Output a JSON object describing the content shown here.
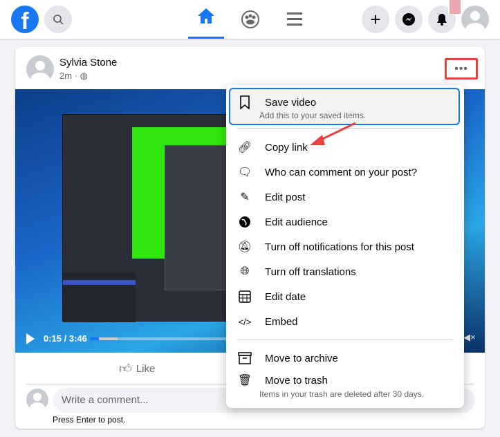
{
  "header": {
    "icons": [
      "facebook-logo",
      "search-icon",
      "home-icon",
      "groups-icon",
      "menu-icon",
      "plus-icon",
      "messenger-icon",
      "bell-icon",
      "avatar"
    ],
    "accent": "#1877f2"
  },
  "post": {
    "author": "Sylvia Stone",
    "time": "2m",
    "separator": "·",
    "video": {
      "time": "0:15 / 3:46",
      "progress": 0.066,
      "buffered": 0.2
    },
    "like_label": "Like",
    "comment_placeholder": "Write a comment...",
    "press_enter": "Press Enter to post."
  },
  "menu": {
    "items": [
      {
        "label": "Save video",
        "sub": "Add this to your saved items.",
        "icon": "bookmark-icon"
      },
      {
        "label": "Copy link",
        "icon": "link-icon"
      },
      {
        "label": "Who can comment on your post?",
        "icon": "comment-icon"
      },
      {
        "label": "Edit post",
        "icon": "pencil-icon"
      },
      {
        "label": "Edit audience",
        "icon": "globe-icon"
      },
      {
        "label": "Turn off notifications for this post",
        "icon": "bell-off-icon"
      },
      {
        "label": "Turn off translations",
        "icon": "translate-icon"
      },
      {
        "label": "Edit date",
        "icon": "calendar-icon"
      },
      {
        "label": "Embed",
        "icon": "code-icon"
      },
      {
        "label": "Move to archive",
        "icon": "archive-icon"
      },
      {
        "label": "Move to trash",
        "sub": "Items in your trash are deleted after 30 days.",
        "icon": "trash-icon"
      }
    ]
  },
  "annotation_color": "#e94040"
}
